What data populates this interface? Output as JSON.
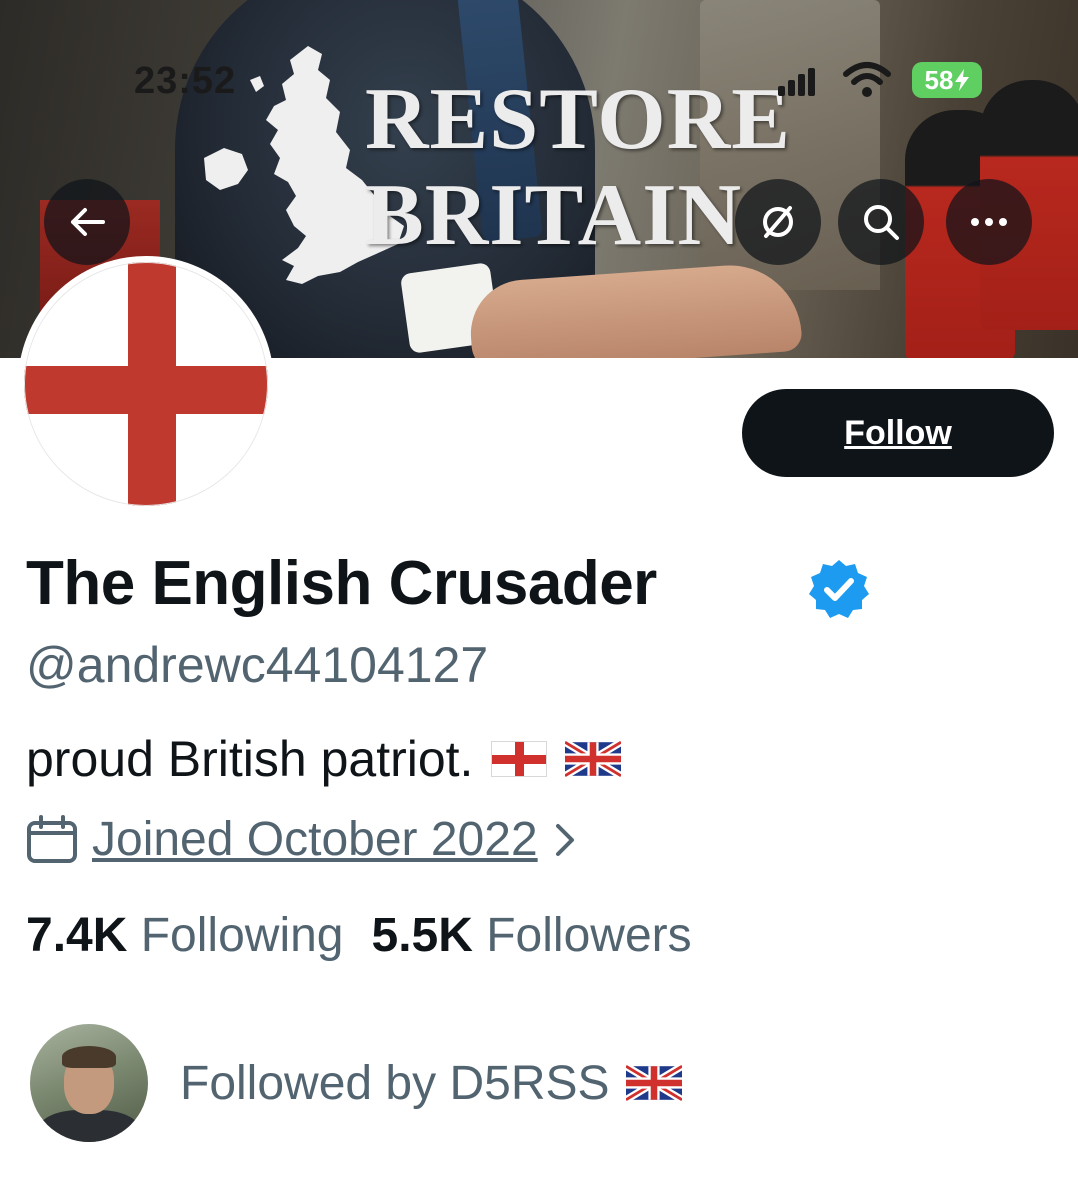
{
  "status_bar": {
    "time": "23:52",
    "battery": "58"
  },
  "banner": {
    "line1": "RESTORE",
    "line2": "BRITAIN"
  },
  "profile": {
    "follow_label": "Follow",
    "display_name": "The English Crusader",
    "handle": "@andrewc44104127",
    "bio": "proud British patriot.",
    "joined": "Joined October 2022",
    "following_count": "7.4K",
    "following_label": "Following",
    "followers_count": "5.5K",
    "followers_label": "Followers",
    "followed_by": "Followed by D5RSS"
  },
  "icons": {
    "back": "arrow-left-icon",
    "grok": "grok-icon",
    "search": "search-icon",
    "more": "more-icon",
    "verified": "verified-badge-icon",
    "calendar": "calendar-icon",
    "chevron": "chevron-right-icon"
  },
  "colors": {
    "verified_blue": "#1d9bf0",
    "text_primary": "#0f1419",
    "text_secondary": "#536471",
    "follow_button_bg": "#0f1419",
    "cross_red": "#c0392f",
    "battery_green": "#5fcf62"
  }
}
